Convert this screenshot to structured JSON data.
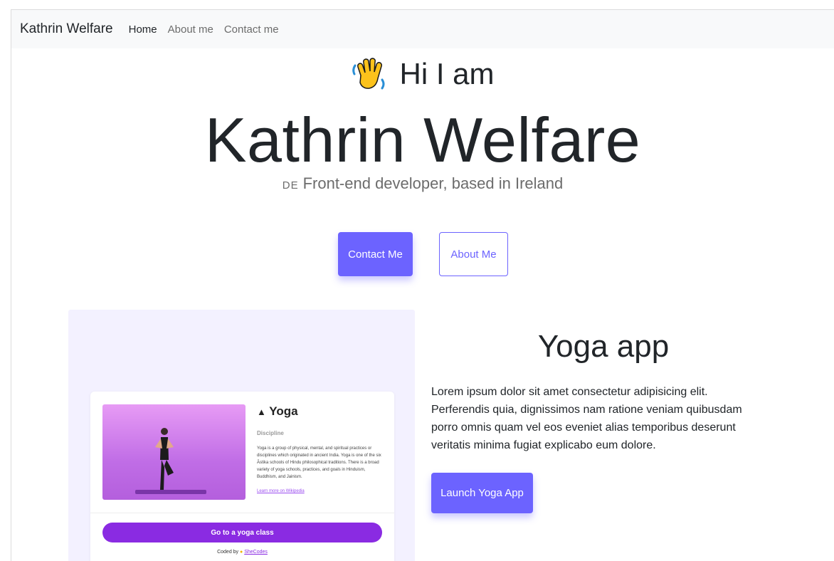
{
  "nav": {
    "brand": "Kathrin Welfare",
    "links": [
      "Home",
      "About me",
      "Contact me"
    ]
  },
  "hero": {
    "greeting": "Hi I am",
    "name": "Kathrin Welfare",
    "flag": "DE",
    "subtitle": "Front-end developer, based in Ireland",
    "contact_button": "Contact Me",
    "about_button": "About Me"
  },
  "project": {
    "title": "Yoga app",
    "description": "Lorem ipsum dolor sit amet consectetur adipisicing elit. Perferendis quia, dignissimos nam ratione veniam quibusdam porro omnis quam vel eos eveniet alias temporibus deserunt veritatis minima fugiat explicabo eum dolore.",
    "launch_button": "Launch Yoga App",
    "preview": {
      "title": "Yoga",
      "discipline": "Discipline",
      "text": "Yoga is a group of physical, mental, and spiritual practices or disciplines which originated in ancient India. Yoga is one of the six Āstika schools of Hindu philosophical traditions. There is a broad variety of yoga schools, practices, and goals in Hinduism, Buddhism, and Jainism.",
      "link": "Learn more on Wikipedia",
      "cta": "Go to a yoga class",
      "coded_by": "Coded by",
      "coded_name": "SheCodes"
    }
  },
  "colors": {
    "accent": "#6c63ff",
    "preview_bg": "#f3f1ff",
    "preview_cta": "#8a2be2"
  }
}
